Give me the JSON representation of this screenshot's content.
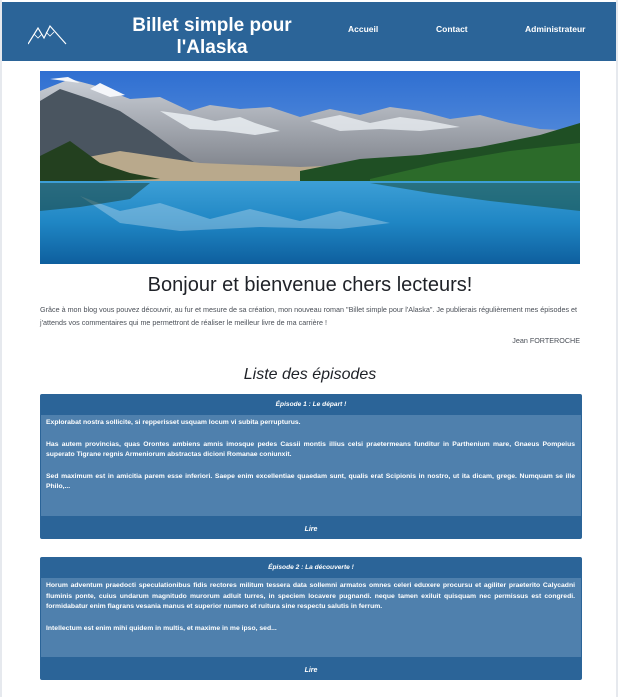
{
  "header": {
    "title": "Billet simple pour l'Alaska",
    "nav": [
      {
        "label": "Accueil"
      },
      {
        "label": "Contact"
      },
      {
        "label": "Administrateur"
      }
    ]
  },
  "welcome": {
    "title": "Bonjour et bienvenue chers lecteurs!",
    "text": "Grâce à mon blog vous pouvez découvrir, au fur et mesure de sa création, mon nouveau roman \"Billet simple pour l'Alaska\". Je publierais régulièrement mes épisodes et j'attends vos commentaires qui me permettront de réaliser le meilleur livre de ma carrière !",
    "signature": "Jean FORTEROCHE"
  },
  "episodes": {
    "title": "Liste des épisodes",
    "items": [
      {
        "title": "Épisode 1 : Le départ !",
        "paragraphs": [
          "Explorabat nostra sollicite, si repperisset usquam locum vi subita perrupturus.",
          "Has autem provincias, quas Orontes ambiens amnis imosque pedes Cassii montis illius celsi praetermeans funditur in Parthenium mare, Gnaeus Pompeius superato Tigrane regnis Armeniorum abstractas dicioni Romanae coniunxit.",
          "Sed maximum est in amicitia parem esse inferiori. Saepe enim excellentiae quaedam sunt, qualis erat Scipionis in nostro, ut ita dicam, grege. Numquam se ille Philo,..."
        ],
        "link": "Lire"
      },
      {
        "title": "Épisode 2 : La découverte !",
        "paragraphs": [
          "Horum adventum praedocti speculationibus fidis rectores militum tessera data sollemni armatos omnes celeri eduxere procursu et agiliter praeterito Calycadni fluminis ponte, cuius undarum magnitudo murorum adluit turres, in speciem locavere pugnandi. neque tamen exiluit quisquam nec permissus est congredi. formidabatur enim flagrans vesania manus et superior numero et ruitura sine respectu salutis in ferrum.",
          "Intellectum est enim mihi quidem in multis, et maxime in me ipso, sed..."
        ],
        "link": "Lire"
      }
    ]
  },
  "colors": {
    "primary": "#2b6498",
    "card_body": "#4f80ad"
  }
}
